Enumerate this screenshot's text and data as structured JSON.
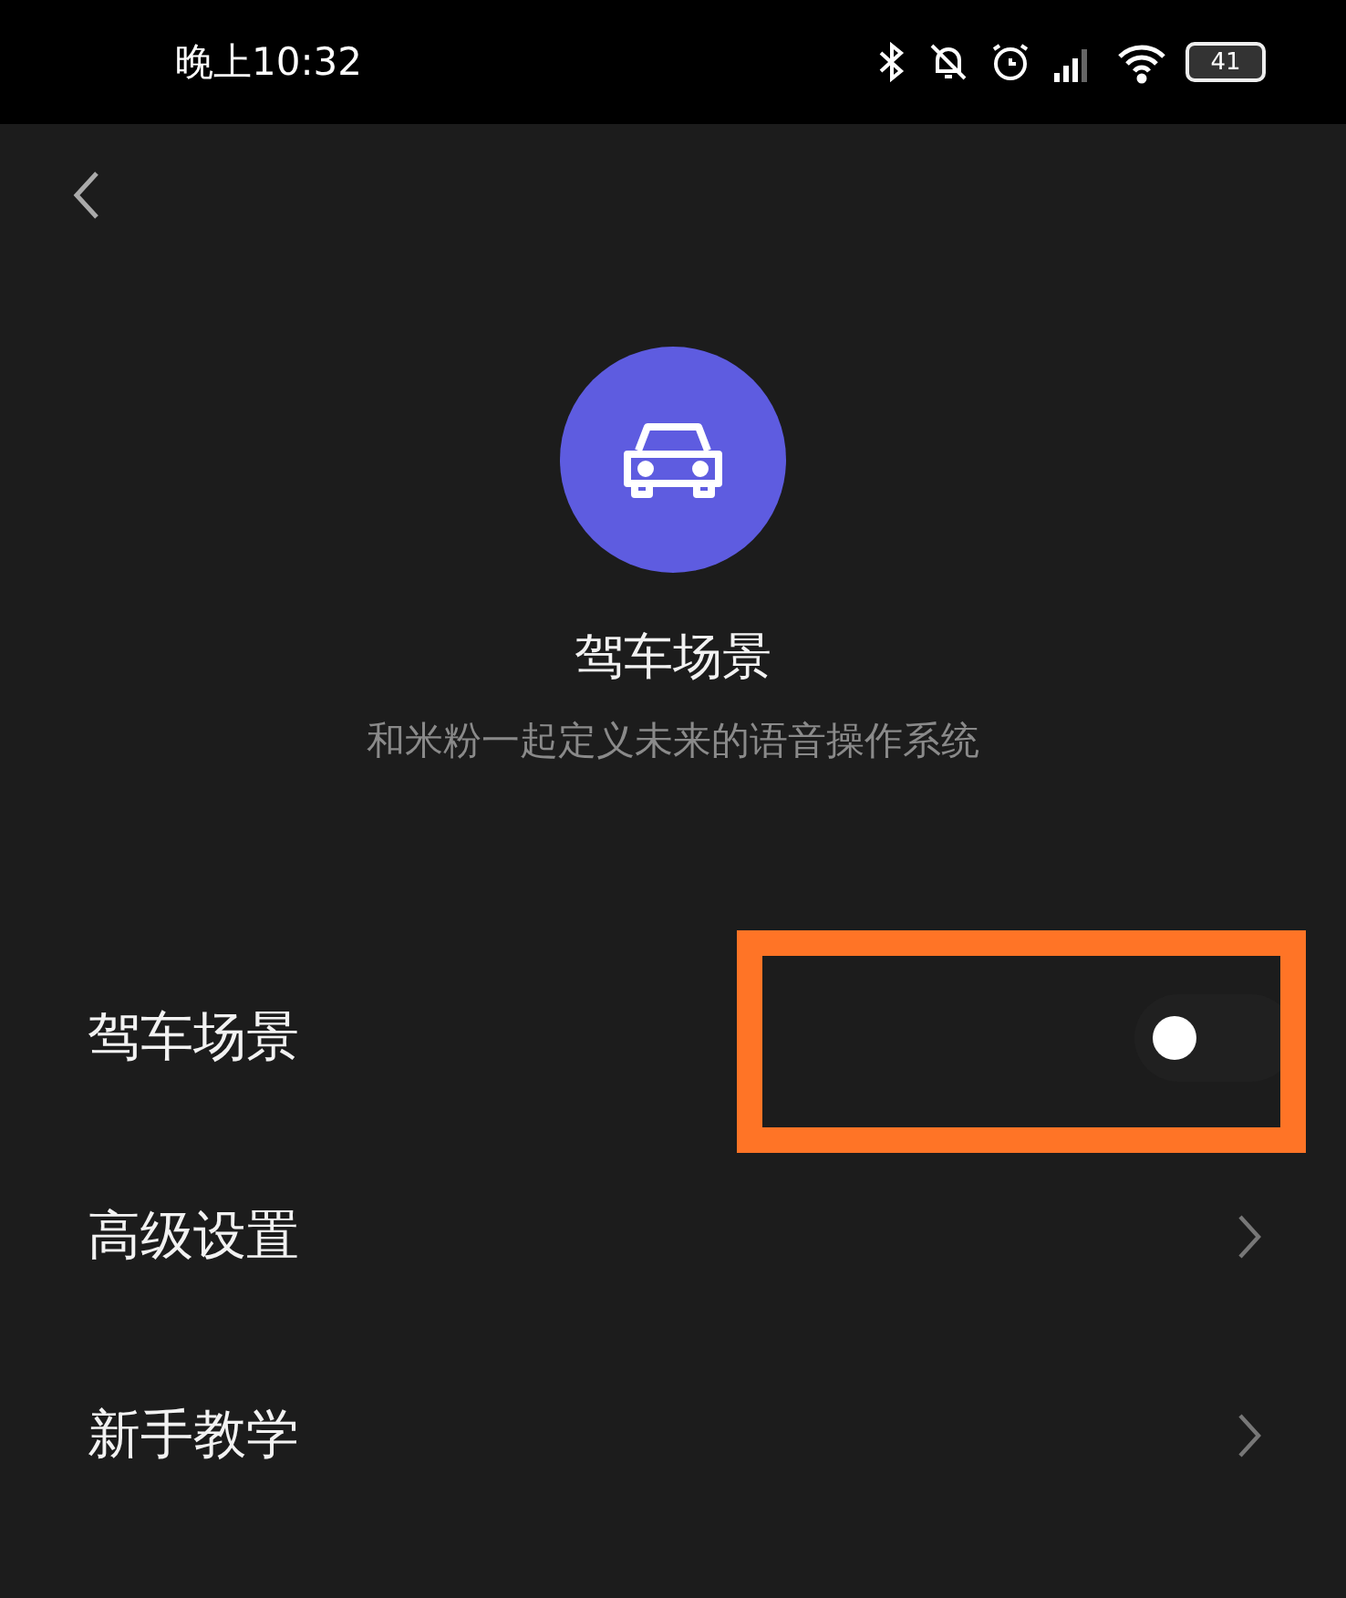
{
  "status_bar": {
    "time": "晚上10:32",
    "battery": "41"
  },
  "header": {
    "title": "驾车场景",
    "subtitle": "和米粉一起定义未来的语音操作系统"
  },
  "settings": [
    {
      "kind": "toggle",
      "label": "驾车场景",
      "on": false,
      "highlighted": true
    },
    {
      "kind": "link",
      "label": "高级设置"
    },
    {
      "kind": "link",
      "label": "新手教学"
    }
  ]
}
